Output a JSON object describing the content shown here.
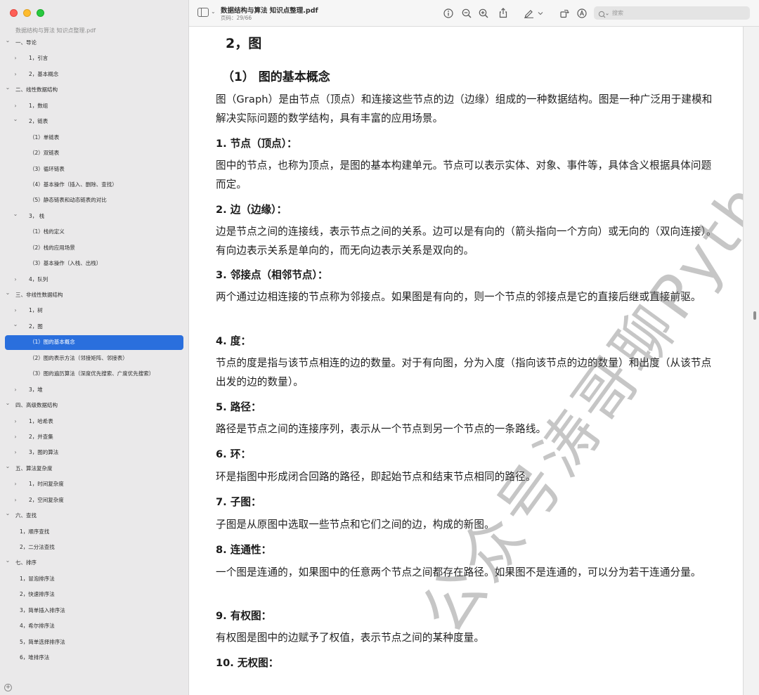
{
  "window": {
    "doc_title": "数据结构与算法 知识点整理.pdf",
    "page_indicator": "页码：29/66"
  },
  "sidebar": {
    "doc_name": "数据结构与算法 知识点整理.pdf",
    "items": [
      {
        "label": "一、导论",
        "level": 0,
        "chevron": "down"
      },
      {
        "label": "1，引言",
        "level": 1,
        "chevron": "right"
      },
      {
        "label": "2，基本概念",
        "level": 1,
        "chevron": "right"
      },
      {
        "label": "二、线性数据结构",
        "level": 0,
        "chevron": "down"
      },
      {
        "label": "1，数组",
        "level": 1,
        "chevron": "right"
      },
      {
        "label": "2，链表",
        "level": 1,
        "chevron": "down"
      },
      {
        "label": "（1）单链表",
        "level": 2,
        "chevron": ""
      },
      {
        "label": "（2）双链表",
        "level": 2,
        "chevron": ""
      },
      {
        "label": "（3）循环链表",
        "level": 2,
        "chevron": ""
      },
      {
        "label": "（4）基本操作（插入、删除、查找）",
        "level": 2,
        "chevron": ""
      },
      {
        "label": "（5）静态链表和动态链表的对比",
        "level": 2,
        "chevron": ""
      },
      {
        "label": "3， 栈",
        "level": 1,
        "chevron": "down"
      },
      {
        "label": "（1）栈的定义",
        "level": 2,
        "chevron": ""
      },
      {
        "label": "（2）栈的应用场景",
        "level": 2,
        "chevron": ""
      },
      {
        "label": "（3）基本操作（入栈、出栈）",
        "level": 2,
        "chevron": ""
      },
      {
        "label": "4，队列",
        "level": 1,
        "chevron": "right"
      },
      {
        "label": "三、非线性数据结构",
        "level": 0,
        "chevron": "down"
      },
      {
        "label": "1，树",
        "level": 1,
        "chevron": "right"
      },
      {
        "label": "2，图",
        "level": 1,
        "chevron": "down"
      },
      {
        "label": "（1）图的基本概念",
        "level": 2,
        "chevron": "",
        "selected": true
      },
      {
        "label": "（2）图的表示方法（邻接矩阵、邻接表）",
        "level": 2,
        "chevron": ""
      },
      {
        "label": "（3）图的遍历算法（深度优先搜索、广度优先搜索）",
        "level": 2,
        "chevron": ""
      },
      {
        "label": "3，堆",
        "level": 1,
        "chevron": "right"
      },
      {
        "label": "四、高级数据结构",
        "level": 0,
        "chevron": "down"
      },
      {
        "label": "1，哈希表",
        "level": 1,
        "chevron": "right"
      },
      {
        "label": "2，并查集",
        "level": 1,
        "chevron": "right"
      },
      {
        "label": "3，图的算法",
        "level": 1,
        "chevron": "right"
      },
      {
        "label": "五、算法复杂度",
        "level": 0,
        "chevron": "down"
      },
      {
        "label": "1，时间复杂度",
        "level": 1,
        "chevron": "right"
      },
      {
        "label": "2，空间复杂度",
        "level": 1,
        "chevron": "right"
      },
      {
        "label": "六、查找",
        "level": 0,
        "chevron": "down"
      },
      {
        "label": "1，顺序查找",
        "level": 1,
        "chevron": ""
      },
      {
        "label": "2，二分法查找",
        "level": 1,
        "chevron": ""
      },
      {
        "label": "七、排序",
        "level": 0,
        "chevron": "down"
      },
      {
        "label": "1，冒泡排序法",
        "level": 1,
        "chevron": ""
      },
      {
        "label": "2，快速排序法",
        "level": 1,
        "chevron": ""
      },
      {
        "label": "3，简单插入排序法",
        "level": 1,
        "chevron": ""
      },
      {
        "label": "4，希尔排序法",
        "level": 1,
        "chevron": ""
      },
      {
        "label": "5，简单选择排序法",
        "level": 1,
        "chevron": ""
      },
      {
        "label": "6，堆排序法",
        "level": 1,
        "chevron": ""
      }
    ]
  },
  "toolbar": {
    "search_placeholder": "搜索",
    "icons": [
      "sidebar-icon",
      "info-icon",
      "zoom-out-icon",
      "zoom-in-icon",
      "share-icon",
      "markup-pen-icon",
      "rotate-icon",
      "annotate-icon",
      "search-icon"
    ]
  },
  "document": {
    "heading": "2，图",
    "subheading": "（1） 图的基本概念",
    "intro": "图（Graph）是由节点（顶点）和连接这些节点的边（边缘）组成的一种数据结构。图是一种广泛用于建模和解决实际问题的数学结构，具有丰富的应用场景。",
    "sections": [
      {
        "title": "1. 节点（顶点）：",
        "body": "图中的节点，也称为顶点，是图的基本构建单元。节点可以表示实体、对象、事件等，具体含义根据具体问题而定。"
      },
      {
        "title": "2. 边（边缘）：",
        "body": "边是节点之间的连接线，表示节点之间的关系。边可以是有向的（箭头指向一个方向）或无向的（双向连接）。有向边表示关系是单向的，而无向边表示关系是双向的。"
      },
      {
        "title": "3. 邻接点（相邻节点）：",
        "body": "两个通过边相连接的节点称为邻接点。如果图是有向的，则一个节点的邻接点是它的直接后继或直接前驱。"
      },
      {
        "title": "4. 度：",
        "body": "节点的度是指与该节点相连的边的数量。对于有向图，分为入度（指向该节点的边的数量）和出度（从该节点出发的边的数量）。"
      },
      {
        "title": "5. 路径：",
        "body": "路径是节点之间的连接序列，表示从一个节点到另一个节点的一条路线。"
      },
      {
        "title": "6. 环：",
        "body": "环是指图中形成闭合回路的路径，即起始节点和结束节点相同的路径。"
      },
      {
        "title": "7. 子图：",
        "body": "子图是从原图中选取一些节点和它们之间的边，构成的新图。"
      },
      {
        "title": "8. 连通性：",
        "body": "一个图是连通的，如果图中的任意两个节点之间都存在路径。如果图不是连通的，可以分为若干连通分量。"
      },
      {
        "title": "9. 有权图：",
        "body": "有权图是图中的边赋予了权值，表示节点之间的某种度量。"
      },
      {
        "title": "10. 无权图：",
        "body": ""
      }
    ],
    "watermark": "公众号涛哥聊Python"
  },
  "colors": {
    "selection": "#2a6fdd",
    "sidebar_bg": "#eae9ea",
    "watermark": "#8a8a8a"
  }
}
